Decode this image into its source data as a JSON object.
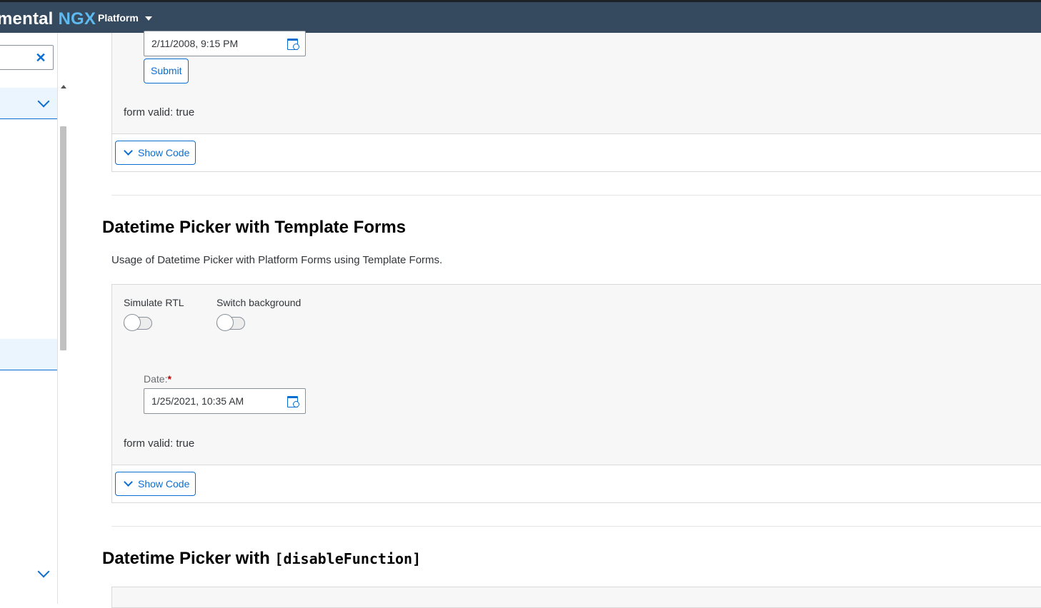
{
  "header": {
    "brand_main": "mental",
    "brand_accent": "NGX",
    "product_menu": "Platform"
  },
  "sidebar": {
    "clear_icon": "close-icon",
    "expand_icon": "chevron-down-icon"
  },
  "examples": [
    {
      "date_value": "2/11/2008, 9:15 PM",
      "submit_label": "Submit",
      "form_valid": "form valid: true",
      "show_code": "Show Code"
    },
    {
      "title": "Datetime Picker with Template Forms",
      "description": "Usage of Datetime Picker with Platform Forms using Template Forms.",
      "simulate_rtl": "Simulate RTL",
      "switch_background": "Switch background",
      "date_label": "Date:",
      "required_mark": "*",
      "date_value": "1/25/2021, 10:35 AM",
      "form_valid": "form valid: true",
      "show_code": "Show Code"
    },
    {
      "title_prefix": "Datetime Picker with",
      "title_code": "[disableFunction]"
    }
  ],
  "colors": {
    "shell": "#354a5f",
    "accent": "#0a6ed1",
    "brand_accent": "#5dbaf0"
  }
}
